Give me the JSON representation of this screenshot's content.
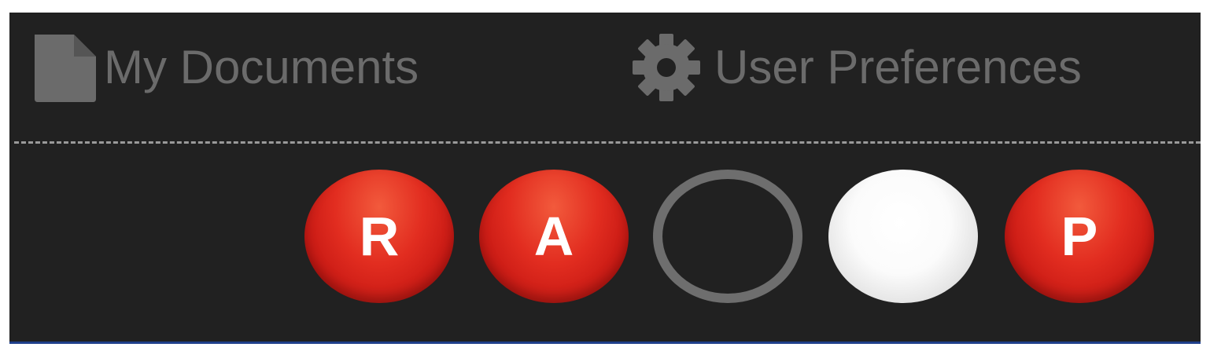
{
  "nav": {
    "documents": {
      "label": "My Documents",
      "icon": "document-icon"
    },
    "preferences": {
      "label": "User Preferences",
      "icon": "gear-icon"
    }
  },
  "status_bubbles": [
    {
      "label": "R",
      "style": "red-filled"
    },
    {
      "label": "A",
      "style": "red-filled"
    },
    {
      "label": "",
      "style": "gray-ring"
    },
    {
      "label": "",
      "style": "white-filled"
    },
    {
      "label": "P",
      "style": "red-filled"
    }
  ],
  "colors": {
    "panel_background": "#212121",
    "nav_text": "#6b6b6b",
    "bubble_red": "#e22d20",
    "ring_gray": "#6e6e6e",
    "bottom_border": "#1f3f8a"
  }
}
